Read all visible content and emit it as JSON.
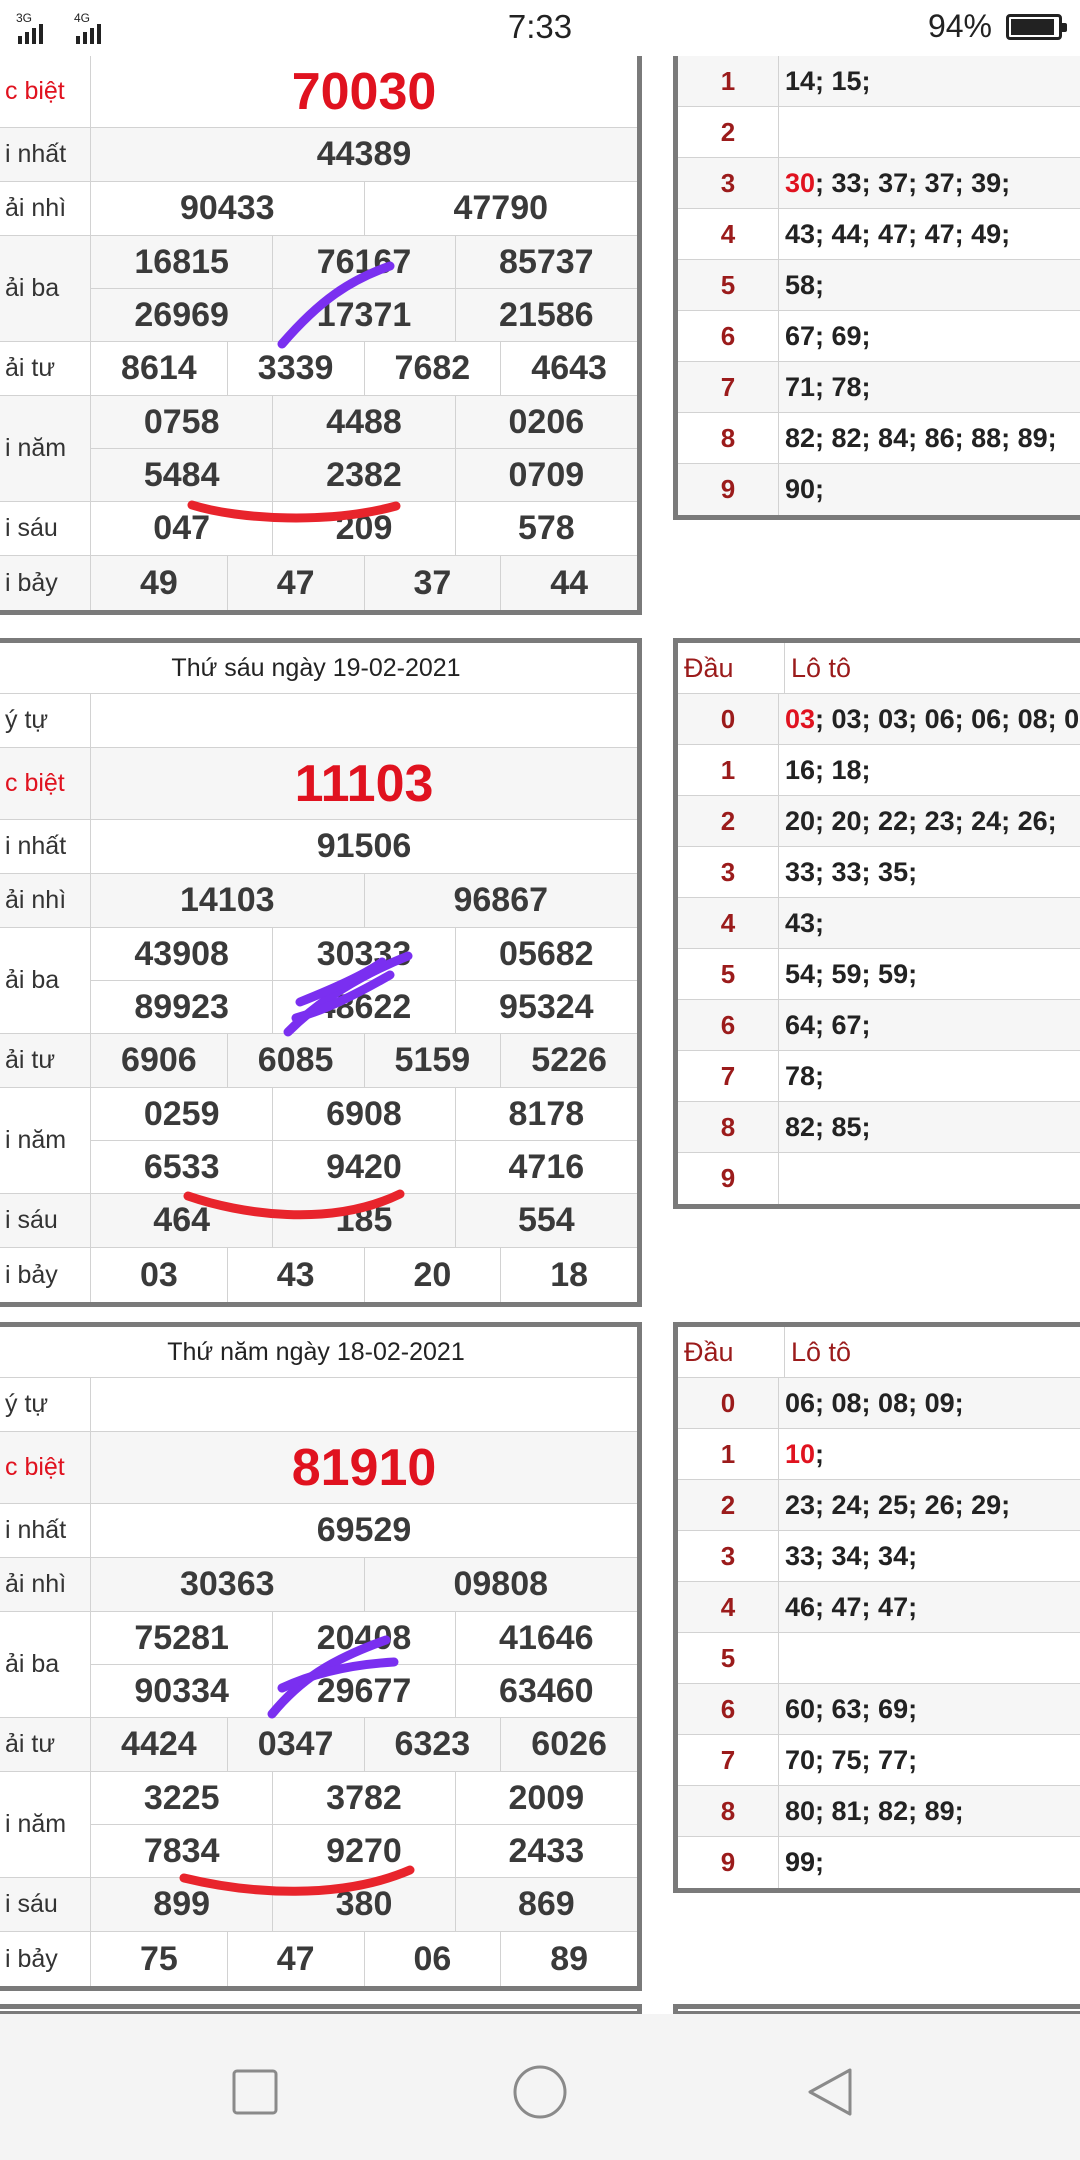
{
  "status_bar": {
    "network": "3G 4G",
    "time": "7:33",
    "battery": "94%",
    "battery_level": 94
  },
  "left_tables": [
    {
      "date": "",
      "rows": [
        {
          "label": "c biệt",
          "red": true,
          "lines": [
            [
              "70030"
            ]
          ],
          "big": true
        },
        {
          "label": "i nhất",
          "lines": [
            [
              "44389"
            ]
          ]
        },
        {
          "label": "ải nhì",
          "lines": [
            [
              "90433",
              "47790"
            ]
          ]
        },
        {
          "label": "ải ba",
          "lines": [
            [
              "16815",
              "76167",
              "85737"
            ],
            [
              "26969",
              "17371",
              "21586"
            ]
          ]
        },
        {
          "label": "ải tư",
          "lines": [
            [
              "8614",
              "3339",
              "7682",
              "4643"
            ]
          ]
        },
        {
          "label": "i năm",
          "lines": [
            [
              "0758",
              "4488",
              "0206"
            ],
            [
              "5484",
              "2382",
              "0709"
            ]
          ]
        },
        {
          "label": "i sáu",
          "lines": [
            [
              "047",
              "209",
              "578"
            ]
          ]
        },
        {
          "label": "i bảy",
          "lines": [
            [
              "49",
              "47",
              "37",
              "44"
            ]
          ]
        }
      ]
    },
    {
      "date": "Thứ sáu ngày 19-02-2021",
      "rows": [
        {
          "label": "ý tự",
          "lines": [
            [
              ""
            ]
          ]
        },
        {
          "label": "c biệt",
          "red": true,
          "lines": [
            [
              "11103"
            ]
          ],
          "big": true
        },
        {
          "label": "i nhất",
          "lines": [
            [
              "91506"
            ]
          ]
        },
        {
          "label": "ải nhì",
          "lines": [
            [
              "14103",
              "96867"
            ]
          ]
        },
        {
          "label": "ải ba",
          "lines": [
            [
              "43908",
              "30333",
              "05682"
            ],
            [
              "89923",
              "48622",
              "95324"
            ]
          ]
        },
        {
          "label": "ải tư",
          "lines": [
            [
              "6906",
              "6085",
              "5159",
              "5226"
            ]
          ]
        },
        {
          "label": "i năm",
          "lines": [
            [
              "0259",
              "6908",
              "8178"
            ],
            [
              "6533",
              "9420",
              "4716"
            ]
          ]
        },
        {
          "label": "i sáu",
          "lines": [
            [
              "464",
              "185",
              "554"
            ]
          ]
        },
        {
          "label": "i bảy",
          "lines": [
            [
              "03",
              "43",
              "20",
              "18"
            ]
          ]
        }
      ]
    },
    {
      "date": "Thứ năm ngày 18-02-2021",
      "rows": [
        {
          "label": "ý tự",
          "lines": [
            [
              ""
            ]
          ]
        },
        {
          "label": "c biệt",
          "red": true,
          "lines": [
            [
              "81910"
            ]
          ],
          "big": true
        },
        {
          "label": "i nhất",
          "lines": [
            [
              "69529"
            ]
          ]
        },
        {
          "label": "ải nhì",
          "lines": [
            [
              "30363",
              "09808"
            ]
          ]
        },
        {
          "label": "ải ba",
          "lines": [
            [
              "75281",
              "20408",
              "41646"
            ],
            [
              "90334",
              "29677",
              "63460"
            ]
          ]
        },
        {
          "label": "ải tư",
          "lines": [
            [
              "4424",
              "0347",
              "6323",
              "6026"
            ]
          ]
        },
        {
          "label": "i năm",
          "lines": [
            [
              "3225",
              "3782",
              "2009"
            ],
            [
              "7834",
              "9270",
              "2433"
            ]
          ]
        },
        {
          "label": "i sáu",
          "lines": [
            [
              "899",
              "380",
              "869"
            ]
          ]
        },
        {
          "label": "i bảy",
          "lines": [
            [
              "75",
              "47",
              "06",
              "89"
            ]
          ]
        }
      ]
    }
  ],
  "right_tables": [
    {
      "header": null,
      "rows": [
        {
          "dau": "1",
          "red": "",
          "rest": "14; 15;"
        },
        {
          "dau": "2",
          "red": "",
          "rest": ""
        },
        {
          "dau": "3",
          "red": "30",
          "rest": "; 33; 37; 37; 39;"
        },
        {
          "dau": "4",
          "red": "",
          "rest": "43; 44; 47; 47; 49;"
        },
        {
          "dau": "5",
          "red": "",
          "rest": "58;"
        },
        {
          "dau": "6",
          "red": "",
          "rest": "67; 69;"
        },
        {
          "dau": "7",
          "red": "",
          "rest": "71; 78;"
        },
        {
          "dau": "8",
          "red": "",
          "rest": "82; 82; 84; 86; 88; 89;"
        },
        {
          "dau": "9",
          "red": "",
          "rest": "90;"
        }
      ]
    },
    {
      "header": {
        "dau": "Đầu",
        "lo": "Lô tô"
      },
      "rows": [
        {
          "dau": "0",
          "red": "03",
          "rest": "; 03; 03; 06; 06; 08; 0"
        },
        {
          "dau": "1",
          "red": "",
          "rest": "16; 18;"
        },
        {
          "dau": "2",
          "red": "",
          "rest": "20; 20; 22; 23; 24; 26;"
        },
        {
          "dau": "3",
          "red": "",
          "rest": "33; 33; 35;"
        },
        {
          "dau": "4",
          "red": "",
          "rest": "43;"
        },
        {
          "dau": "5",
          "red": "",
          "rest": "54; 59; 59;"
        },
        {
          "dau": "6",
          "red": "",
          "rest": "64; 67;"
        },
        {
          "dau": "7",
          "red": "",
          "rest": "78;"
        },
        {
          "dau": "8",
          "red": "",
          "rest": "82; 85;"
        },
        {
          "dau": "9",
          "red": "",
          "rest": ""
        }
      ]
    },
    {
      "header": {
        "dau": "Đầu",
        "lo": "Lô tô"
      },
      "rows": [
        {
          "dau": "0",
          "red": "",
          "rest": "06; 08; 08; 09;"
        },
        {
          "dau": "1",
          "red": "10",
          "rest": ";"
        },
        {
          "dau": "2",
          "red": "",
          "rest": "23; 24; 25; 26; 29;"
        },
        {
          "dau": "3",
          "red": "",
          "rest": "33; 34; 34;"
        },
        {
          "dau": "4",
          "red": "",
          "rest": "46; 47; 47;"
        },
        {
          "dau": "5",
          "red": "",
          "rest": ""
        },
        {
          "dau": "6",
          "red": "",
          "rest": "60; 63; 69;"
        },
        {
          "dau": "7",
          "red": "",
          "rest": "70; 75; 77;"
        },
        {
          "dau": "8",
          "red": "",
          "rest": "80; 81; 82; 89;"
        },
        {
          "dau": "9",
          "red": "",
          "rest": "99;"
        }
      ]
    }
  ],
  "colors": {
    "accent_red": "#e0121f",
    "dau_red": "#9b1b1b",
    "border": "#7a7a7a",
    "marker_purple": "#7a2ff0",
    "marker_red": "#e8242c"
  },
  "nav_bar": {
    "recents_icon": "square-icon",
    "home_icon": "circle-icon",
    "back_icon": "triangle-back-icon"
  }
}
